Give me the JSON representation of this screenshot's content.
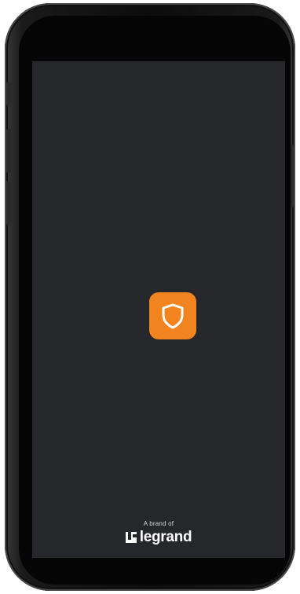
{
  "splash": {
    "brand_caption": "A brand of",
    "brand_name": "legrand",
    "icon": "shield-icon",
    "icon_bg_color": "#f28420",
    "screen_bg_color": "#26272b"
  }
}
